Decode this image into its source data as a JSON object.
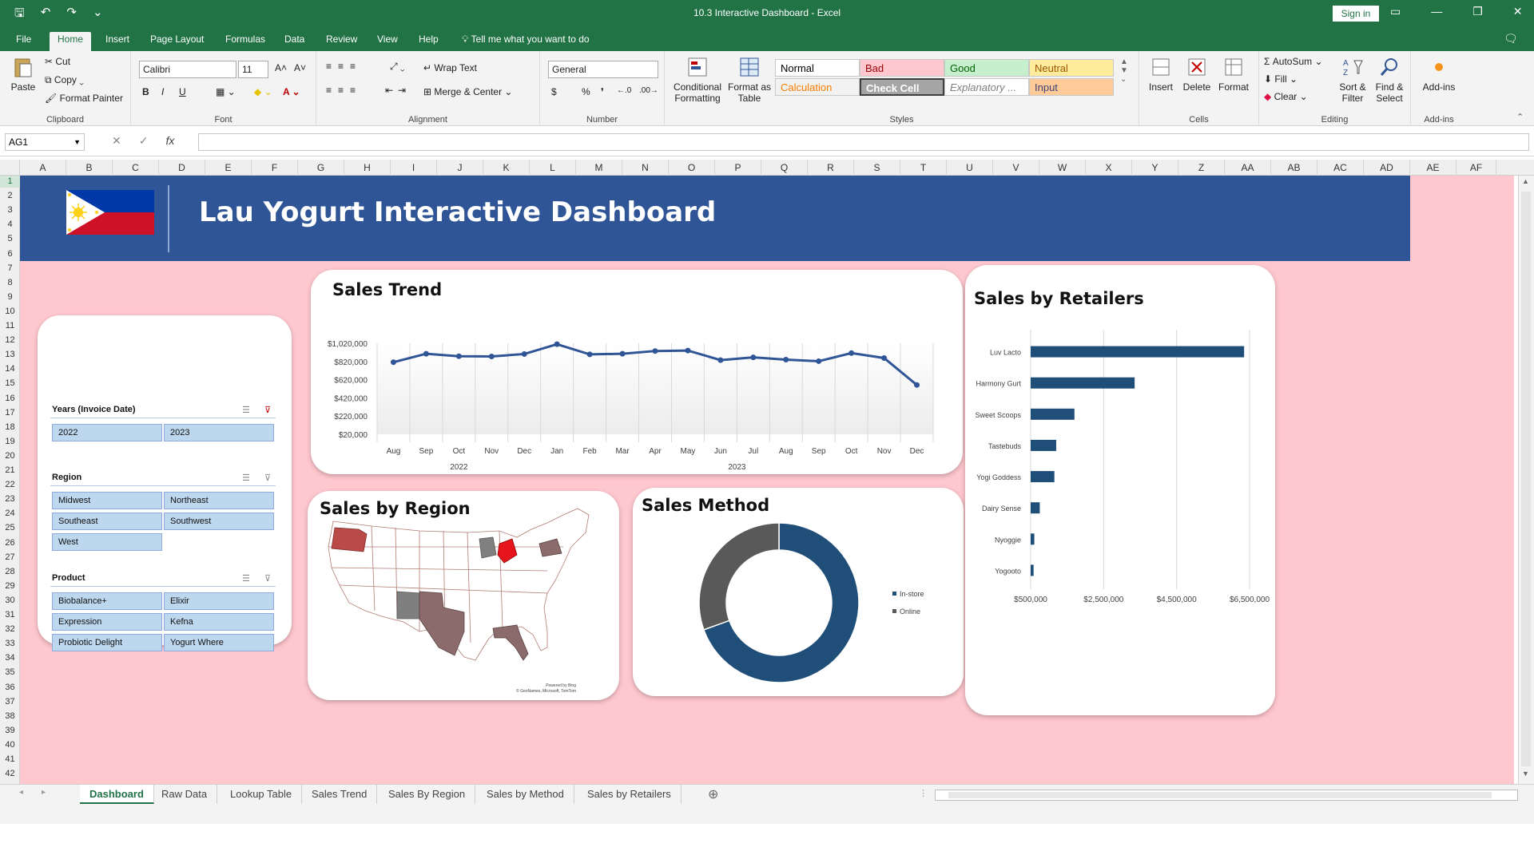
{
  "window": {
    "title": "10.3 Interactive Dashboard  -  Excel",
    "signin": "Sign in",
    "qat_save": "🖫",
    "qat_undo": "↶",
    "qat_redo": "↷",
    "qat_more": "⌄",
    "min": "—",
    "restore": "❐",
    "close": "✕",
    "ribbon_display": "▭"
  },
  "ribbon_tabs": [
    "File",
    "Home",
    "Insert",
    "Page Layout",
    "Formulas",
    "Data",
    "Review",
    "View",
    "Help"
  ],
  "tell_me": "Tell me what you want to do",
  "clipboard": {
    "paste": "Paste",
    "cut": "Cut",
    "copy": "Copy",
    "format_painter": "Format Painter",
    "label": "Clipboard"
  },
  "font": {
    "name": "Calibri",
    "size": "11",
    "bold": "B",
    "italic": "I",
    "underline": "U",
    "grow": "A˄",
    "shrink": "A˅",
    "label": "Font"
  },
  "alignment": {
    "wrap": "Wrap Text",
    "merge": "Merge & Center",
    "label": "Alignment"
  },
  "number": {
    "format": "General",
    "currency": "$",
    "percent": "%",
    "comma": "❜",
    "inc": "←.0",
    "dec": ".00→",
    "label": "Number"
  },
  "styles": {
    "conditional": "Conditional Formatting",
    "format_table": "Format as Table",
    "cells": [
      {
        "label": "Normal",
        "bg": "#ffffff",
        "fg": "#000000"
      },
      {
        "label": "Bad",
        "bg": "#ffc7ce",
        "fg": "#9c0006"
      },
      {
        "label": "Good",
        "bg": "#c6efce",
        "fg": "#006100"
      },
      {
        "label": "Neutral",
        "bg": "#ffeb9c",
        "fg": "#9c5700"
      },
      {
        "label": "Calculation",
        "bg": "#f2f2f2",
        "fg": "#fa7d00"
      },
      {
        "label": "Check Cell",
        "bg": "#a5a5a5",
        "fg": "#ffffff"
      },
      {
        "label": "Explanatory ...",
        "bg": "#ffffff",
        "fg": "#7f7f7f"
      },
      {
        "label": "Input",
        "bg": "#ffcc99",
        "fg": "#3f3f76"
      }
    ],
    "label": "Styles"
  },
  "cells_group": {
    "insert": "Insert",
    "delete": "Delete",
    "format": "Format",
    "label": "Cells"
  },
  "editing": {
    "autosum": "AutoSum",
    "fill": "Fill",
    "clear": "Clear",
    "sort": "Sort & Filter",
    "find": "Find & Select",
    "label": "Editing"
  },
  "addins": {
    "button": "Add-ins",
    "label": "Add-ins"
  },
  "formula_bar": {
    "name_box": "AG1",
    "cancel": "✕",
    "enter": "✓",
    "fx": "fx",
    "value": ""
  },
  "columns": [
    "A",
    "B",
    "C",
    "D",
    "E",
    "F",
    "G",
    "H",
    "I",
    "J",
    "K",
    "L",
    "M",
    "N",
    "O",
    "P",
    "Q",
    "R",
    "S",
    "T",
    "U",
    "V",
    "W",
    "X",
    "Y",
    "Z",
    "AA",
    "AB",
    "AC",
    "AD",
    "AE",
    "AF"
  ],
  "rows": [
    "1",
    "2",
    "3",
    "4",
    "5",
    "6",
    "7",
    "8",
    "9",
    "10",
    "11",
    "12",
    "13",
    "14",
    "15",
    "16",
    "17",
    "18",
    "19",
    "20",
    "21",
    "22",
    "23",
    "24",
    "25",
    "26",
    "27",
    "28",
    "29",
    "30",
    "31",
    "32",
    "33",
    "34",
    "35",
    "36",
    "37",
    "38",
    "39",
    "40",
    "41",
    "42"
  ],
  "dashboard": {
    "title": "Lau Yogurt Interactive Dashboard",
    "banner_color": "#2f5597",
    "background_color": "#ffc7ce"
  },
  "slicers": [
    {
      "title": "Years (Invoice Date)",
      "items": [
        "2022",
        "2023"
      ]
    },
    {
      "title": "Region",
      "items": [
        "Midwest",
        "Northeast",
        "Southeast",
        "Southwest",
        "West"
      ]
    },
    {
      "title": "Product",
      "items": [
        "Biobalance+",
        "Elixir",
        "Expression",
        "Kefna",
        "Probiotic Delight",
        "Yogurt Where"
      ]
    }
  ],
  "sales_trend": {
    "title": "Sales Trend",
    "chart_data": {
      "type": "line",
      "title": "Sales Trend",
      "x": [
        "Aug",
        "Sep",
        "Oct",
        "Nov",
        "Dec",
        "Jan",
        "Feb",
        "Mar",
        "Apr",
        "May",
        "Jun",
        "Jul",
        "Aug",
        "Sep",
        "Oct",
        "Nov",
        "Dec"
      ],
      "year_groups": [
        {
          "label": "2022",
          "count": 5
        },
        {
          "label": "2023",
          "count": 12
        }
      ],
      "series": [
        {
          "values": [
            812000,
            905000,
            878000,
            875000,
            902000,
            1010000,
            898000,
            905000,
            935000,
            940000,
            835000,
            865000,
            840000,
            823000,
            912000,
            858000,
            562000
          ]
        }
      ],
      "yticks": [
        "$1,020,000",
        "$820,000",
        "$620,000",
        "$420,000",
        "$220,000",
        "$20,000"
      ],
      "ylim": [
        20000,
        1020000
      ],
      "color": "#2f5597",
      "grid": true
    }
  },
  "sales_region": {
    "title": "Sales by Region",
    "attribution_1": "Powered by Bing",
    "attribution_2": "© GeoNames, Microsoft, TomTom"
  },
  "sales_method": {
    "title": "Sales Method",
    "chart_data": {
      "type": "pie",
      "donut": true,
      "labels": [
        "In-store",
        "Online"
      ],
      "values": [
        69.5,
        30.5
      ],
      "colors": [
        "#1f4e79",
        "#595959"
      ],
      "legend": "right"
    }
  },
  "sales_retailers": {
    "title": "Sales by Retailers",
    "chart_data": {
      "type": "bar",
      "orientation": "horizontal",
      "categories": [
        "Luv Lacto",
        "Harmony Gurt",
        "Sweet Scoops",
        "Tastebuds",
        "Yogi Goddess",
        "Dairy Sense",
        "Nyoggie",
        "Yogooto"
      ],
      "values": [
        6350000,
        3350000,
        1700000,
        1200000,
        1150000,
        750000,
        600000,
        580000
      ],
      "xticks": [
        "$500,000",
        "$2,500,000",
        "$4,500,000",
        "$6,500,000"
      ],
      "xlim": [
        500000,
        6500000
      ],
      "color": "#1f4e79",
      "grid": true
    }
  },
  "sheet_tabs": [
    "Dashboard",
    "Raw Data",
    "Lookup Table",
    "Sales Trend",
    "Sales By Region",
    "Sales by Method",
    "Sales by Retailers"
  ],
  "add_sheet": "⊕"
}
